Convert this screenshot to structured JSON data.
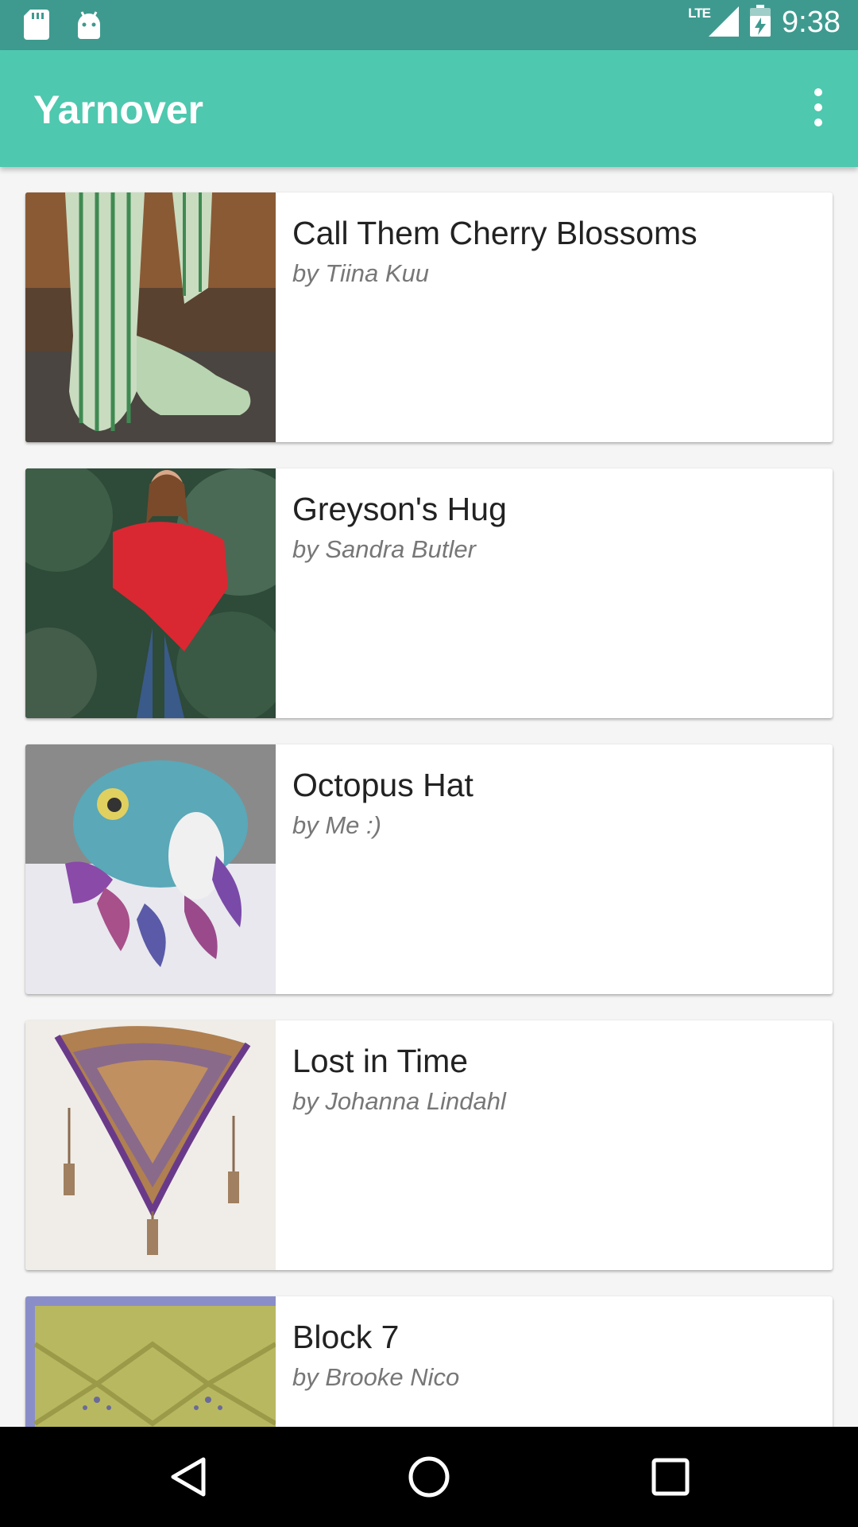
{
  "status_bar": {
    "network": "LTE",
    "time": "9:38"
  },
  "app_bar": {
    "title": "Yarnover"
  },
  "patterns": [
    {
      "title": "Call Them Cherry Blossoms",
      "author": "by Tiina Kuu"
    },
    {
      "title": "Greyson's Hug",
      "author": "by Sandra Butler"
    },
    {
      "title": "Octopus Hat",
      "author": "by Me :)"
    },
    {
      "title": "Lost in Time",
      "author": "by Johanna Lindahl"
    },
    {
      "title": "Block 7",
      "author": "by Brooke Nico"
    }
  ],
  "colors": {
    "status_bar": "#3e9a8f",
    "app_bar": "#4ec8ae",
    "background": "#f5f5f5",
    "nav_bar": "#000000"
  },
  "icons": {
    "status_left": [
      "sd-card-icon",
      "android-icon"
    ],
    "status_right": [
      "signal-icon",
      "battery-icon"
    ],
    "app_bar": "more-vert-icon",
    "nav": [
      "back-icon",
      "home-icon",
      "recents-icon"
    ]
  }
}
